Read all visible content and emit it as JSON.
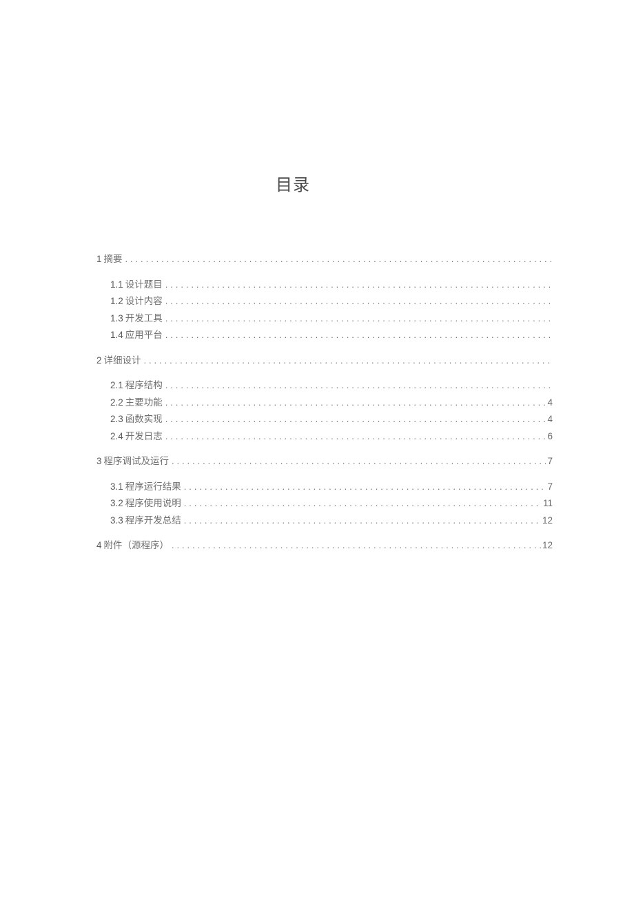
{
  "title": "目录",
  "dots": "..................................................................................................................................",
  "toc": [
    {
      "num": "1",
      "label": "摘要",
      "page": "",
      "children": [
        {
          "num": "1.1",
          "label": "设计题目",
          "page": ""
        },
        {
          "num": "1.2",
          "label": "设计内容",
          "page": ""
        },
        {
          "num": "1.3",
          "label": "开发工具",
          "page": ""
        },
        {
          "num": "1.4",
          "label": "应用平台",
          "page": ""
        }
      ]
    },
    {
      "num": "2",
      "label": "详细设计",
      "page": "",
      "children": [
        {
          "num": "2.1",
          "label": "程序结构",
          "page": ""
        },
        {
          "num": "2.2",
          "label": "主要功能",
          "page": "4"
        },
        {
          "num": "2.3",
          "label": "函数实现",
          "page": "4"
        },
        {
          "num": "2.4",
          "label": "开发日志",
          "page": "6"
        }
      ]
    },
    {
      "num": "3",
      "label": "程序调试及运行",
      "page": "7",
      "children": [
        {
          "num": "3.1",
          "label": "程序运行结果",
          "page": "7"
        },
        {
          "num": "3.2",
          "label": "程序使用说明",
          "page": "11"
        },
        {
          "num": "3.3",
          "label": "程序开发总结",
          "page": "12"
        }
      ]
    },
    {
      "num": "4",
      "label": "附件（源程序）",
      "page": "12",
      "children": []
    }
  ]
}
